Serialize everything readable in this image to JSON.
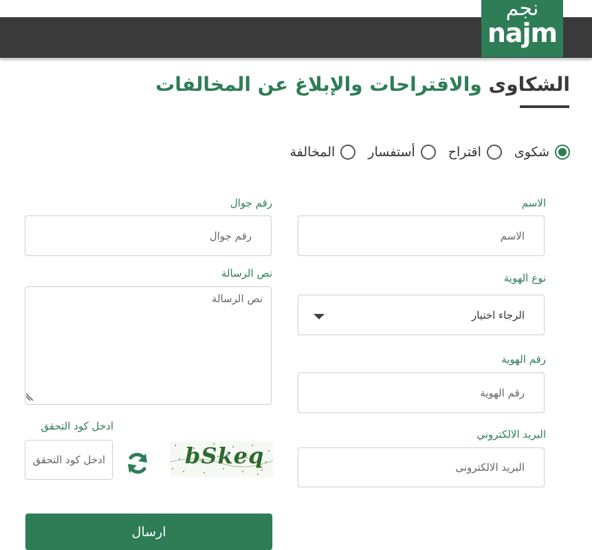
{
  "brand": {
    "logo_ar": "نجم",
    "logo_en": "najm",
    "color": "#2e7d57",
    "header_bg": "#3a3a3a"
  },
  "title": {
    "highlight": "الشكاوى",
    "rest": " والاقتراحات والإبلاغ عن المخالفات"
  },
  "request_type": {
    "selected": "شكوى",
    "options": [
      {
        "label": "شكوى",
        "checked": true
      },
      {
        "label": "اقتراح",
        "checked": false
      },
      {
        "label": "أستفسار",
        "checked": false
      },
      {
        "label": "المخالفة",
        "checked": false
      }
    ]
  },
  "form": {
    "name": {
      "label": "الاسم",
      "placeholder": "الاسم",
      "value": ""
    },
    "mobile": {
      "label": "رقم جوال",
      "placeholder": "رقم جوال",
      "value": ""
    },
    "id_type": {
      "label": "نوع الهوية",
      "selected": "الرجاء اختيار"
    },
    "message": {
      "label": "نص الرسالة",
      "placeholder": "نص الرسالة",
      "value": ""
    },
    "id_number": {
      "label": "رقم الهوية",
      "placeholder": "رقم الهوية",
      "value": ""
    },
    "email": {
      "label": "البريد الالكتروني",
      "placeholder": "البريد الالكترونى",
      "value": ""
    },
    "captcha": {
      "label": "ادخل كود التحقق",
      "placeholder": "ادخل كود التحقق",
      "image_text": "bSkeq",
      "value": ""
    },
    "submit_label": "ارسال"
  },
  "icons": {
    "refresh": "refresh-icon",
    "caret": "caret-down-icon",
    "radio": "radio-icon"
  }
}
